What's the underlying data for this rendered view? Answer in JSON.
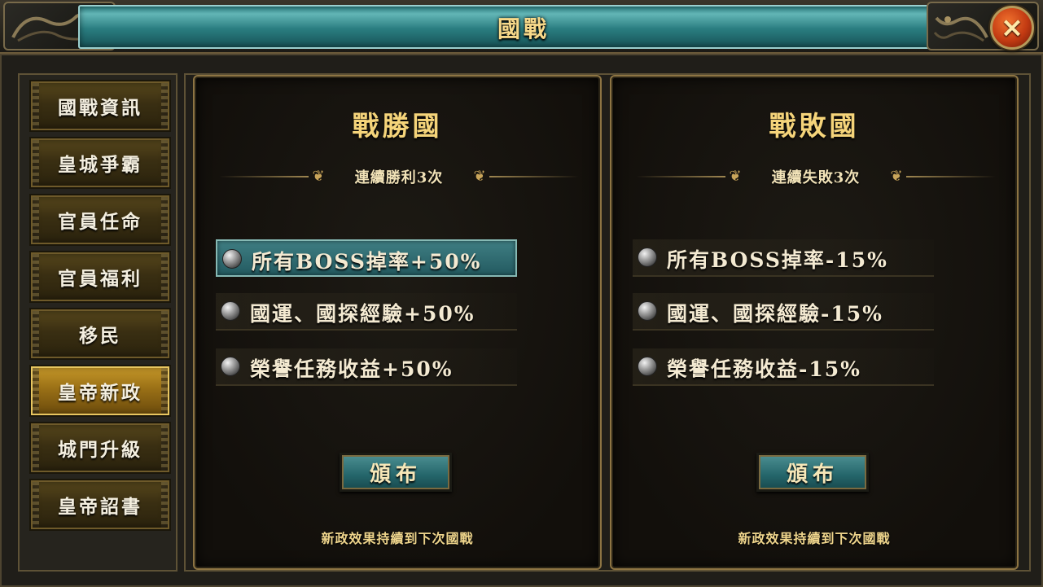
{
  "window": {
    "title": "國戰",
    "close_icon": "close-x-icon",
    "colors": {
      "title_band": "#2f8487",
      "title_text": "#f7d98a",
      "close": "#d9471a"
    }
  },
  "sidebar": {
    "items": [
      {
        "label": "國戰資訊",
        "active": false
      },
      {
        "label": "皇城爭霸",
        "active": false
      },
      {
        "label": "官員任命",
        "active": false
      },
      {
        "label": "官員福利",
        "active": false
      },
      {
        "label": "移民",
        "active": false
      },
      {
        "label": "皇帝新政",
        "active": true
      },
      {
        "label": "城門升級",
        "active": false
      },
      {
        "label": "皇帝詔書",
        "active": false
      }
    ]
  },
  "panels": {
    "winner": {
      "title": "戰勝國",
      "streak": "連續勝利3次",
      "bonuses": [
        "所有BOSS掉率+50%",
        "國運、國探經驗+50%",
        "榮譽任務收益+50%"
      ],
      "button": "頒布",
      "note": "新政效果持續到下次國戰"
    },
    "loser": {
      "title": "戰敗國",
      "streak": "連續失敗3次",
      "bonuses": [
        "所有BOSS掉率-15%",
        "國運、國探經驗-15%",
        "榮譽任務收益-15%"
      ],
      "button": "頒布",
      "note": "新政效果持續到下次國戰"
    }
  }
}
